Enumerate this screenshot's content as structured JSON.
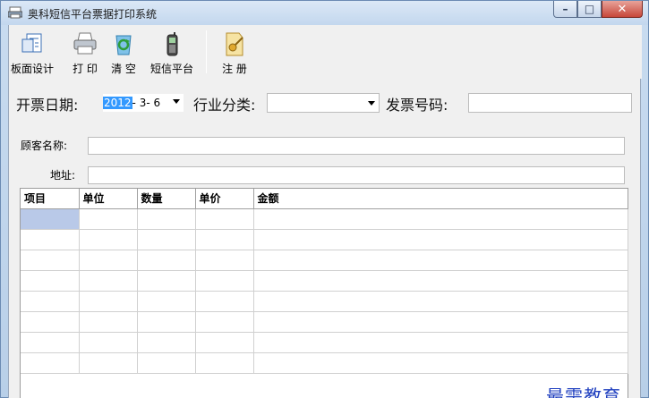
{
  "window": {
    "title": "奥科短信平台票据打印系统",
    "controls": {
      "minimize": "–",
      "maximize": "□",
      "close": "✕"
    }
  },
  "toolbar": {
    "items": [
      {
        "label": "板面设计",
        "icon": "layout-design-icon"
      },
      {
        "label": "打 印",
        "icon": "printer-icon"
      },
      {
        "label": "清 空",
        "icon": "recycle-clear-icon"
      },
      {
        "label": "短信平台",
        "icon": "mobile-phone-icon"
      },
      {
        "label": "注 册",
        "icon": "key-register-icon"
      }
    ]
  },
  "form": {
    "date_label": "开票日期:",
    "date_value": {
      "year": "2012",
      "rest": "- 3- 6"
    },
    "industry_label": "行业分类:",
    "industry_value": "",
    "invoice_label": "发票号码:",
    "invoice_value": "",
    "customer_label": "顾客名称:",
    "customer_value": "",
    "address_label": "地址:",
    "address_value": ""
  },
  "grid": {
    "columns": [
      "项目",
      "单位",
      "数量",
      "单价",
      "金额"
    ],
    "rows": 8
  },
  "watermark": "最需教育",
  "colors": {
    "accent": "#3399ff",
    "selected_cell": "#b9c9e8",
    "watermark": "#1f3fbf"
  }
}
